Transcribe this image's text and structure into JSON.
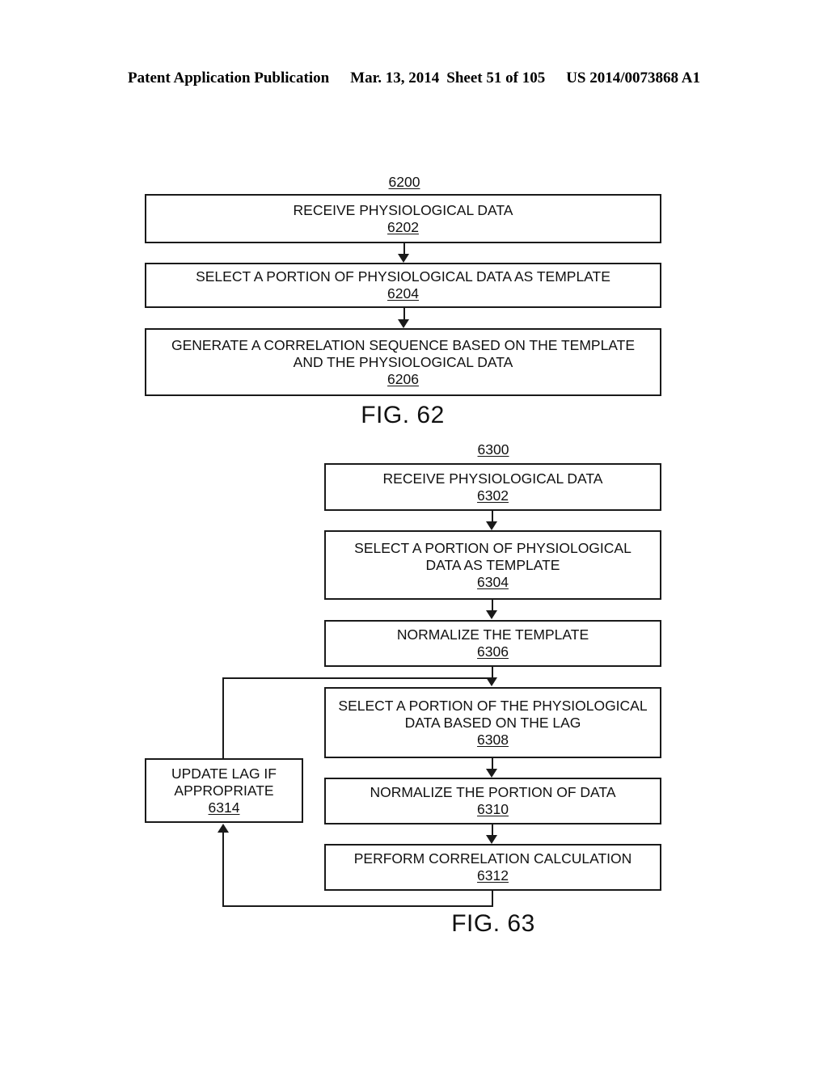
{
  "header": {
    "publication": "Patent Application Publication",
    "date": "Mar. 13, 2014",
    "sheet": "Sheet 51 of 105",
    "patent_number": "US 2014/0073868 A1"
  },
  "figures": [
    {
      "id": "fig-62",
      "caption": "FIG. 62",
      "diagram_ref": "6200",
      "nodes": [
        {
          "ref": "6202",
          "lines": [
            "RECEIVE PHYSIOLOGICAL DATA"
          ]
        },
        {
          "ref": "6204",
          "lines": [
            "SELECT A PORTION OF PHYSIOLOGICAL DATA AS TEMPLATE"
          ]
        },
        {
          "ref": "6206",
          "lines": [
            "GENERATE A CORRELATION SEQUENCE BASED ON THE TEMPLATE",
            "AND THE PHYSIOLOGICAL DATA"
          ]
        }
      ]
    },
    {
      "id": "fig-63",
      "caption": "FIG. 63",
      "diagram_ref": "6300",
      "nodes": [
        {
          "ref": "6302",
          "lines": [
            "RECEIVE PHYSIOLOGICAL DATA"
          ]
        },
        {
          "ref": "6304",
          "lines": [
            "SELECT A PORTION OF PHYSIOLOGICAL",
            "DATA AS TEMPLATE"
          ]
        },
        {
          "ref": "6306",
          "lines": [
            "NORMALIZE THE TEMPLATE"
          ]
        },
        {
          "ref": "6308",
          "lines": [
            "SELECT A PORTION OF THE PHYSIOLOGICAL",
            "DATA BASED ON THE LAG"
          ]
        },
        {
          "ref": "6310",
          "lines": [
            "NORMALIZE THE PORTION OF DATA"
          ]
        },
        {
          "ref": "6312",
          "lines": [
            "PERFORM CORRELATION CALCULATION"
          ]
        },
        {
          "ref": "6314",
          "lines": [
            "UPDATE LAG IF",
            "APPROPRIATE"
          ]
        }
      ]
    }
  ],
  "colors": {
    "ink": "#1a1a1a",
    "paper": "#ffffff"
  }
}
